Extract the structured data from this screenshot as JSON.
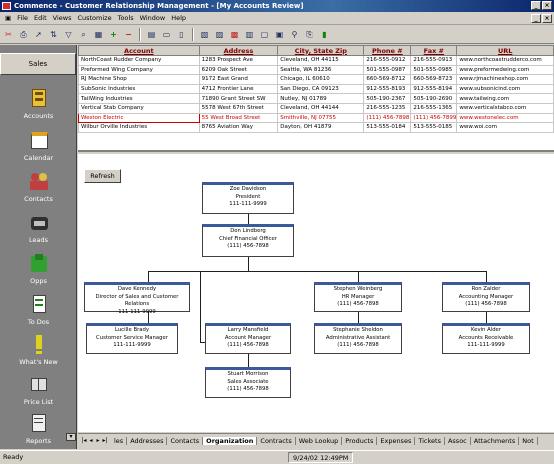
{
  "window": {
    "title": "Commence - Customer Relationship Management - [My Accounts Review]"
  },
  "menu": [
    "File",
    "Edit",
    "Views",
    "Customize",
    "Tools",
    "Window",
    "Help"
  ],
  "toolbar_icons": [
    "cut-icon",
    "print-icon",
    "cursor-icon",
    "sort-icon",
    "filter-icon",
    "search-icon",
    "grid-add-icon",
    "add-icon",
    "remove-icon",
    "view-icon",
    "save-icon",
    "book-icon",
    "report-icon",
    "chart-icon",
    "calendar-icon",
    "table-icon",
    "form-icon",
    "layout-icon",
    "binoculars-icon",
    "print-preview-icon",
    "phone-icon"
  ],
  "sidebar": {
    "header": "Sales",
    "items": [
      {
        "label": "Accounts",
        "icon": "building-icon"
      },
      {
        "label": "Calendar",
        "icon": "calendar-icon"
      },
      {
        "label": "Contacts",
        "icon": "contacts-icon"
      },
      {
        "label": "Leads",
        "icon": "phone-icon"
      },
      {
        "label": "Opps",
        "icon": "opportunity-icon"
      },
      {
        "label": "To Dos",
        "icon": "checklist-icon"
      },
      {
        "label": "What's New",
        "icon": "whats-new-icon"
      },
      {
        "label": "Price List",
        "icon": "book-icon"
      },
      {
        "label": "Reports",
        "icon": "reports-icon"
      }
    ]
  },
  "grid": {
    "columns": [
      "Account",
      "Address",
      "City, State Zip",
      "Phone #",
      "Fax #",
      "URL"
    ],
    "rows": [
      [
        "NorthCoast Rudder Company",
        "1283 Prospect Ave",
        "Cleveland, OH 44115",
        "216-555-0912",
        "216-555-0913",
        "www.northcoastrudderco.com"
      ],
      [
        "Preformed Wing Company",
        "6209 Oak Street",
        "Seattle, WA 81236",
        "501-555-0987",
        "501-555-0985",
        "www.preformedwing.com"
      ],
      [
        "RJ Machine Shop",
        "9172 East Grand",
        "Chicago, IL 60610",
        "660-569-8712",
        "660-569-8723",
        "www.rjmachineshop.com"
      ],
      [
        "SubSonic Industries",
        "4712 Frontier Lane",
        "San Diego, CA 09123",
        "912-555-8193",
        "912-555-8194",
        "www.subsonicind.com"
      ],
      [
        "TailWing Industries",
        "71890 Grant Street SW",
        "Nutley, NJ 01789",
        "505-190-2367",
        "505-190-2690",
        "www.tailwing.com"
      ],
      [
        "Vertical Stab Company",
        "5578 West 67th Street",
        "Cleveland, OH 44144",
        "216-555-1235",
        "216-555-1365",
        "www.verticalstabco.com"
      ],
      [
        "Weston Electric",
        "55 West Broad Street",
        "Smithville, NJ 07755",
        "(111) 456-7898",
        "(111) 456-7899",
        "www.westonelec.com"
      ],
      [
        "Wilbur Orville Industries",
        "8765 Aviation Way",
        "Dayton, OH 41879",
        "513-555-0184",
        "513-555-0185",
        "www.woi.com"
      ]
    ],
    "selected_row": 6
  },
  "org": {
    "refresh_label": "Refresh",
    "nodes": [
      {
        "name": "Zoe Davidson",
        "title": "President",
        "phone": "111-111-9999"
      },
      {
        "name": "Don Lindberg",
        "title": "Chief Financial Officer",
        "phone": "(111) 456-7898"
      },
      {
        "name": "Dave Kennedy",
        "title": "Director of Sales and Customer Relations",
        "phone": "111-111-9999"
      },
      {
        "name": "Stephen Weinberg",
        "title": "HR Manager",
        "phone": "(111) 456-7898"
      },
      {
        "name": "Ron Zalder",
        "title": "Accounting Manager",
        "phone": "(111) 456-7898"
      },
      {
        "name": "Lucille Brady",
        "title": "Customer Service Manager",
        "phone": "111-111-9999"
      },
      {
        "name": "Larry Mansfield",
        "title": "Account Manager",
        "phone": "(111) 456-7898"
      },
      {
        "name": "Stephanie Sheldon",
        "title": "Administrative Assistant",
        "phone": "(111) 456-7898"
      },
      {
        "name": "Kevin Alder",
        "title": "Accounts Receivable",
        "phone": "111-111-9999"
      },
      {
        "name": "Stuart Morrison",
        "title": "Sales Associate",
        "phone": "(111) 456-7898"
      }
    ]
  },
  "tabs": [
    "les",
    "Addresses",
    "Contacts",
    "Organization",
    "Contracts",
    "Web Lookup",
    "Products",
    "Expenses",
    "Tickets",
    "Assoc",
    "Attachments",
    "Not"
  ],
  "active_tab": "Organization",
  "status": {
    "text": "Ready",
    "timestamp": "9/24/02  12:49PM"
  }
}
